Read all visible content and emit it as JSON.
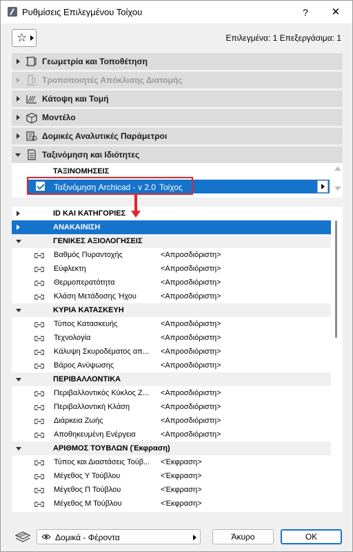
{
  "window": {
    "title": "Ρυθμίσεις Επιλεγμένου Τοίχου",
    "help_label": "?",
    "close_label": "✕"
  },
  "toolbar": {
    "favorites_label": "☆",
    "selected_info": "Επιλεγμένα: 1 Επεξεργάσιμα: 1"
  },
  "sections": [
    {
      "label": "Γεωμετρία και Τοποθέτηση",
      "icon": "geometry-icon",
      "expanded": false,
      "disabled": false
    },
    {
      "label": "Τροποποιητές Απόκλισης Διατομής",
      "icon": "profile-modifier-icon",
      "expanded": false,
      "disabled": true
    },
    {
      "label": "Κάτοψη και Τομή",
      "icon": "floorplan-section-icon",
      "expanded": false,
      "disabled": false
    },
    {
      "label": "Μοντέλο",
      "icon": "model-icon",
      "expanded": false,
      "disabled": false
    },
    {
      "label": "Δομικές Αναλυτικές Παράμετροι",
      "icon": "structural-analytical-icon",
      "expanded": false,
      "disabled": false
    },
    {
      "label": "Ταξινόμηση και Ιδιότητες",
      "icon": "classification-icon",
      "expanded": true,
      "disabled": false
    }
  ],
  "classifications": {
    "header": "ΤΑΞΙΝΟΜΗΣΕΙΣ",
    "row": {
      "checked": true,
      "name": "Ταξινόμηση Archicad - v 2.0",
      "value": "Τοίχος"
    }
  },
  "properties": {
    "groups": [
      {
        "label": "ID ΚΑΙ ΚΑΤΗΓΟΡΙΕΣ",
        "expanded": false,
        "selected": false,
        "items": []
      },
      {
        "label": "ΑΝΑΚΑΙΝΙΣΗ",
        "expanded": false,
        "selected": true,
        "items": []
      },
      {
        "label": "ΓΕΝΙΚΕΣ ΑΞΙΟΛΟΓΗΣΕΙΣ",
        "expanded": true,
        "selected": false,
        "items": [
          {
            "name": "Βαθμός Πυραντοχής",
            "value": "<Απροσδιόριστη>"
          },
          {
            "name": "Εύφλεκτη",
            "value": "<Απροσδιόριστη>"
          },
          {
            "name": "Θερμοπερατότητα",
            "value": "<Απροσδιόριστη>"
          },
          {
            "name": "Κλάση Μετάδοσης Ήχου",
            "value": "<Απροσδιόριστη>"
          }
        ]
      },
      {
        "label": "ΚΥΡΙΑ ΚΑΤΑΣΚΕΥΗ",
        "expanded": true,
        "selected": false,
        "items": [
          {
            "name": "Τύπος Κατασκευής",
            "value": "<Απροσδιόριστη>"
          },
          {
            "name": "Τεχνολογία",
            "value": "<Απροσδιόριστη>"
          },
          {
            "name": "Κάλυψη Σκυροδέματος απ...",
            "value": "<Απροσδιόριστη>"
          },
          {
            "name": "Βάρος Ανύψωσης",
            "value": "<Απροσδιόριστη>"
          }
        ]
      },
      {
        "label": "ΠΕΡΙΒΑΛΛΟΝΤΙΚΑ",
        "expanded": true,
        "selected": false,
        "items": [
          {
            "name": "Περιβαλλοντικός Κύκλος Ζ...",
            "value": "<Απροσδιόριστη>"
          },
          {
            "name": "Περιβαλλοντική Κλάση",
            "value": "<Απροσδιόριστη>"
          },
          {
            "name": "Διάρκεια Ζωής",
            "value": "<Απροσδιόριστη>"
          },
          {
            "name": "Αποθηκευμένη Ενέργεια",
            "value": "<Απροσδιόριστη>"
          }
        ]
      },
      {
        "label": "ΑΡΙΘΜΟΣ ΤΟΥΒΛΩΝ (Έκφραση)",
        "expanded": true,
        "selected": false,
        "items": [
          {
            "name": "Τύπος και Διαστάσεις Τούβ...",
            "value": "<Έκφραση>"
          },
          {
            "name": "Μέγεθος Υ Τούβλου",
            "value": "<Έκφραση>"
          },
          {
            "name": "Μέγεθος Π Τούβλου",
            "value": "<Έκφραση>"
          },
          {
            "name": "Μέγεθος Μ Τούβλου",
            "value": "<Έκφραση>"
          }
        ]
      }
    ]
  },
  "footer": {
    "layer_label": "Δομικά - Φέροντα",
    "cancel_label": "Άκυρο",
    "ok_label": "OK"
  },
  "colors": {
    "accent": "#1673cc",
    "highlight": "#e52424"
  }
}
